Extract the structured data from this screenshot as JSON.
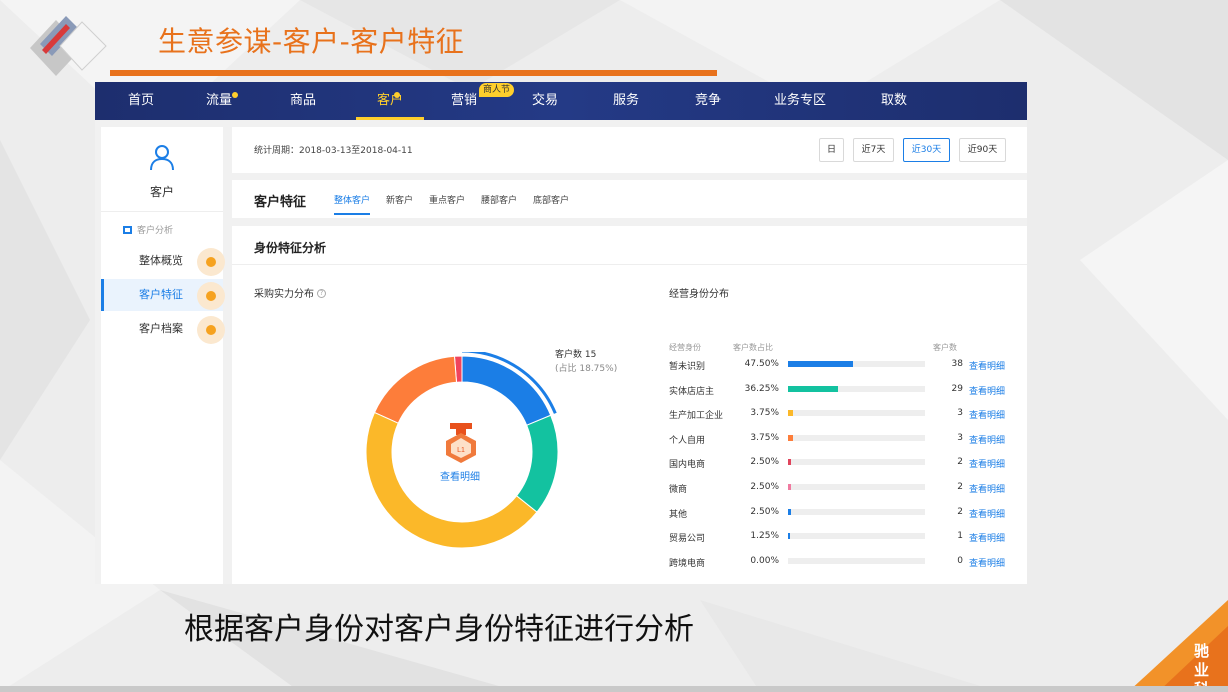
{
  "slide": {
    "title": "生意参谋-客户-客户特征",
    "caption": "根据客户身份对客户身份特征进行分析",
    "brand_line1": "驰 业",
    "brand_line2": "科 技",
    "accent_color": "#e8721c"
  },
  "topnav": {
    "items": [
      {
        "label": "首页"
      },
      {
        "label": "流量"
      },
      {
        "label": "商品"
      },
      {
        "label": "客户"
      },
      {
        "label": "营销"
      },
      {
        "label": "交易"
      },
      {
        "label": "服务"
      },
      {
        "label": "竞争"
      },
      {
        "label": "业务专区"
      },
      {
        "label": "取数"
      }
    ],
    "active": "客户",
    "badge": "商人节",
    "bg_color": "#1d2e6e",
    "highlight_color": "#ffcf2c"
  },
  "sidebar": {
    "icon": "user-icon",
    "title": "客户",
    "group_label": "客户分析",
    "items": [
      {
        "label": "整体概览"
      },
      {
        "label": "客户特征"
      },
      {
        "label": "客户档案"
      }
    ],
    "active": "客户特征"
  },
  "period": {
    "text": "统计周期：2018-03-13至2018-04-11",
    "buttons": [
      "日",
      "近7天",
      "近30天",
      "近90天"
    ],
    "active": "近30天"
  },
  "tabs": {
    "title": "客户特征",
    "items": [
      "整体客户",
      "新客户",
      "重点客户",
      "腰部客户",
      "底部客户"
    ],
    "active": "整体客户"
  },
  "section": {
    "title": "身份特征分析",
    "left_title": "采购实力分布",
    "right_title": "经营身份分布"
  },
  "donut": {
    "callout_label": "客户数 15",
    "callout_sub": "(占比 18.75%)",
    "center_link": "查看明细",
    "center_icon": "medal-icon",
    "segments": [
      {
        "value": 18.75,
        "color": "#1b7ee6"
      },
      {
        "value": 17,
        "color": "#13c2a0"
      },
      {
        "value": 46,
        "color": "#fbb829"
      },
      {
        "value": 17,
        "color": "#fd7d3a"
      },
      {
        "value": 1.25,
        "color": "#f0445c"
      }
    ]
  },
  "identity_table": {
    "headers": {
      "name": "经营身份",
      "pct": "客户数占比",
      "count": "客户数"
    },
    "link_label": "查看明细",
    "rows": [
      {
        "name": "暂未识别",
        "pct": "47.50%",
        "value": 47.5,
        "count": "38",
        "color": "#1b7ee6"
      },
      {
        "name": "实体店店主",
        "pct": "36.25%",
        "value": 36.25,
        "count": "29",
        "color": "#13c2a0"
      },
      {
        "name": "生产加工企业",
        "pct": "3.75%",
        "value": 3.75,
        "count": "3",
        "color": "#fbb829"
      },
      {
        "name": "个人自用",
        "pct": "3.75%",
        "value": 3.75,
        "count": "3",
        "color": "#fd7d3a"
      },
      {
        "name": "国内电商",
        "pct": "2.50%",
        "value": 2.5,
        "count": "2",
        "color": "#e0445c"
      },
      {
        "name": "微商",
        "pct": "2.50%",
        "value": 2.5,
        "count": "2",
        "color": "#f07aa0"
      },
      {
        "name": "其他",
        "pct": "2.50%",
        "value": 2.5,
        "count": "2",
        "color": "#1b7ee6"
      },
      {
        "name": "贸易公司",
        "pct": "1.25%",
        "value": 1.25,
        "count": "1",
        "color": "#1b7ee6"
      },
      {
        "name": "跨境电商",
        "pct": "0.00%",
        "value": 0,
        "count": "0",
        "color": "#1b7ee6"
      }
    ]
  }
}
